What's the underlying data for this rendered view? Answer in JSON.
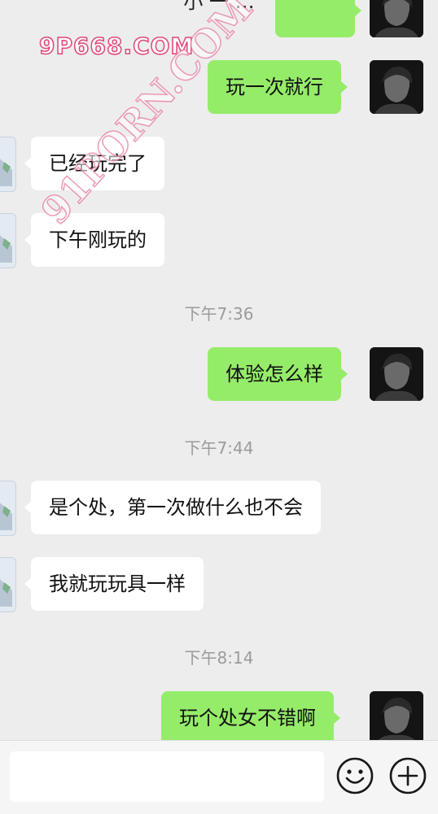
{
  "header": {
    "title_fragment": "小 一 …"
  },
  "watermarks": {
    "top_left": "9P668.COM",
    "diagonal": "91PORN.COM"
  },
  "messages": [
    {
      "side": "out",
      "text": ""
    },
    {
      "side": "out",
      "text": "玩一次就行"
    },
    {
      "side": "in",
      "text": "已经玩完了"
    },
    {
      "side": "in",
      "text": "下午刚玩的"
    },
    {
      "type": "time",
      "text": "下午7:36"
    },
    {
      "side": "out",
      "text": "体验怎么样"
    },
    {
      "type": "time",
      "text": "下午7:44"
    },
    {
      "side": "in",
      "text": "是个处，第一次做什么也不会"
    },
    {
      "side": "in",
      "text": "我就玩玩具一样"
    },
    {
      "type": "time",
      "text": "下午8:14"
    },
    {
      "side": "out",
      "text": "玩个处女不错啊"
    }
  ],
  "input_bar": {
    "value": ""
  },
  "icons": {
    "emoji": "emoji-icon",
    "plus": "plus-icon"
  },
  "colors": {
    "bubble_out": "#95ec69",
    "bubble_in": "#ffffff",
    "background": "#ededed"
  }
}
